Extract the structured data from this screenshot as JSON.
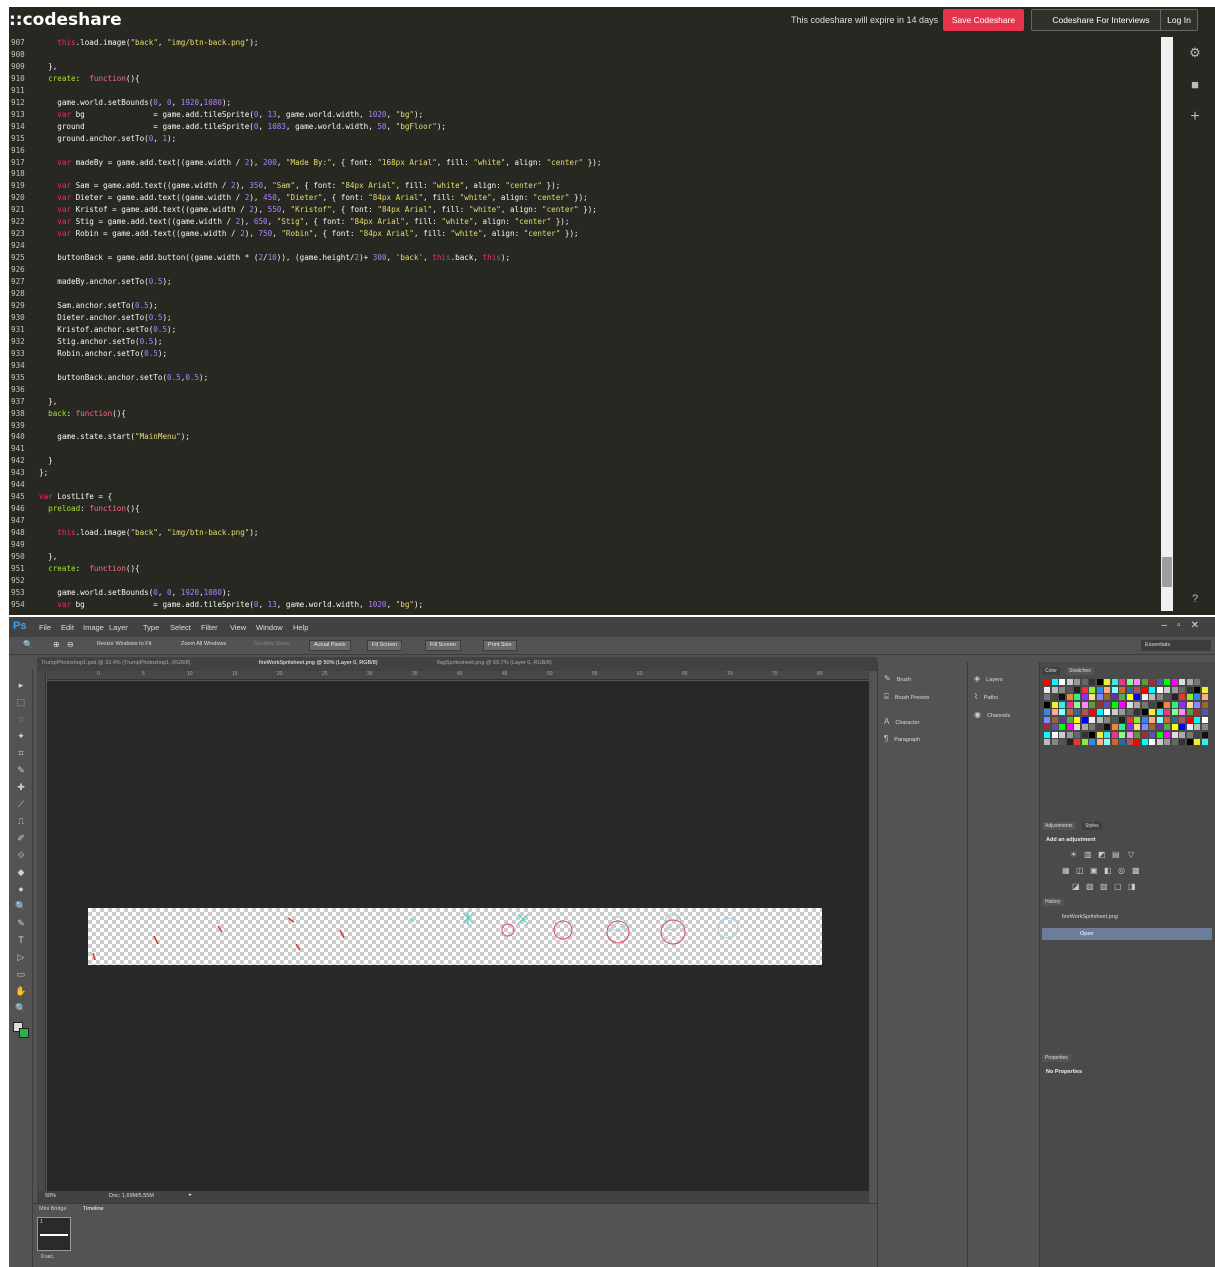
{
  "codeshare": {
    "logo": "::codeshare",
    "expire_text": "This codeshare will expire in 14 days",
    "save_label": "Save Codeshare",
    "interviews_label": "Codeshare For Interviews",
    "login_label": "Log In",
    "side_icons": [
      "gear-icon",
      "camera-icon",
      "plus-icon",
      "help-icon",
      "close-icon"
    ],
    "lines": [
      {
        "n": "907",
        "t": "    this.load.image(\"back\", \"img/btn-back.png\");"
      },
      {
        "n": "908",
        "t": ""
      },
      {
        "n": "909",
        "t": "  },"
      },
      {
        "n": "910",
        "t": "  create:  function(){"
      },
      {
        "n": "911",
        "t": ""
      },
      {
        "n": "912",
        "t": "    game.world.setBounds(0, 0, 1920,1080);"
      },
      {
        "n": "913",
        "t": "    var bg               = game.add.tileSprite(0, 13, game.world.width, 1020, \"bg\");"
      },
      {
        "n": "914",
        "t": "    ground               = game.add.tileSprite(0, 1083, game.world.width, 50, \"bgFloor\");"
      },
      {
        "n": "915",
        "t": "    ground.anchor.setTo(0, 1);"
      },
      {
        "n": "916",
        "t": ""
      },
      {
        "n": "917",
        "t": "    var madeBy = game.add.text((game.width / 2), 200, \"Made By:\", { font: \"168px Arial\", fill: \"white\", align: \"center\" });"
      },
      {
        "n": "918",
        "t": ""
      },
      {
        "n": "919",
        "t": "    var Sam = game.add.text((game.width / 2), 350, \"Sam\", { font: \"84px Arial\", fill: \"white\", align: \"center\" });"
      },
      {
        "n": "920",
        "t": "    var Dieter = game.add.text((game.width / 2), 450, \"Dieter\", { font: \"84px Arial\", fill: \"white\", align: \"center\" });"
      },
      {
        "n": "921",
        "t": "    var Kristof = game.add.text((game.width / 2), 550, \"Kristof\", { font: \"84px Arial\", fill: \"white\", align: \"center\" });"
      },
      {
        "n": "922",
        "t": "    var Stig = game.add.text((game.width / 2), 650, \"Stig\", { font: \"84px Arial\", fill: \"white\", align: \"center\" });"
      },
      {
        "n": "923",
        "t": "    var Robin = game.add.text((game.width / 2), 750, \"Robin\", { font: \"84px Arial\", fill: \"white\", align: \"center\" });"
      },
      {
        "n": "924",
        "t": ""
      },
      {
        "n": "925",
        "t": "    buttonBack = game.add.button((game.width * (2/10)), (game.height/2)+ 300, 'back', this.back, this);"
      },
      {
        "n": "926",
        "t": ""
      },
      {
        "n": "927",
        "t": "    madeBy.anchor.setTo(0.5);"
      },
      {
        "n": "928",
        "t": ""
      },
      {
        "n": "929",
        "t": "    Sam.anchor.setTo(0.5);"
      },
      {
        "n": "930",
        "t": "    Dieter.anchor.setTo(0.5);"
      },
      {
        "n": "931",
        "t": "    Kristof.anchor.setTo(0.5);"
      },
      {
        "n": "932",
        "t": "    Stig.anchor.setTo(0.5);"
      },
      {
        "n": "933",
        "t": "    Robin.anchor.setTo(0.5);"
      },
      {
        "n": "934",
        "t": ""
      },
      {
        "n": "935",
        "t": "    buttonBack.anchor.setTo(0.5,0.5);"
      },
      {
        "n": "936",
        "t": ""
      },
      {
        "n": "937",
        "t": "  },"
      },
      {
        "n": "938",
        "t": "  back: function(){"
      },
      {
        "n": "939",
        "t": ""
      },
      {
        "n": "940",
        "t": "    game.state.start(\"MainMenu\");"
      },
      {
        "n": "941",
        "t": ""
      },
      {
        "n": "942",
        "t": "  }"
      },
      {
        "n": "943",
        "t": "};"
      },
      {
        "n": "944",
        "t": ""
      },
      {
        "n": "945",
        "t": "var LostLife = {"
      },
      {
        "n": "946",
        "t": "  preload: function(){"
      },
      {
        "n": "947",
        "t": ""
      },
      {
        "n": "948",
        "t": "    this.load.image(\"back\", \"img/btn-back.png\");"
      },
      {
        "n": "949",
        "t": ""
      },
      {
        "n": "950",
        "t": "  },"
      },
      {
        "n": "951",
        "t": "  create:  function(){"
      },
      {
        "n": "952",
        "t": ""
      },
      {
        "n": "953",
        "t": "    game.world.setBounds(0, 0, 1920,1080);"
      },
      {
        "n": "954",
        "t": "    var bg               = game.add.tileSprite(0, 13, game.world.width, 1020, \"bg\");"
      }
    ]
  },
  "photoshop": {
    "logo": "Ps",
    "menu": [
      "File",
      "Edit",
      "Image",
      "Layer",
      "Type",
      "Select",
      "Filter",
      "View",
      "Window",
      "Help"
    ],
    "options": {
      "resize_windows": "Resize Windows to Fit",
      "zoom_all": "Zoom All Windows",
      "scrubby_zoom": "Scrubby Zoom",
      "actual_pixels": "Actual Pixels",
      "fit_screen": "Fit Screen",
      "fill_screen": "Fill Screen",
      "print_size": "Print Size",
      "workspace": "Essentials"
    },
    "tabs": [
      "TrumpPhotoshop1.psd @ 33.4% (TrumpPhotoshop1, RGB/8)",
      "fireWorkSpritsheet.png @ 50% (Layer 0, RGB/8)",
      "flagSpritesheet.png @ 66.7% (Layer 0, RGB/8)"
    ],
    "ruler_numbers": [
      "0",
      "5",
      "10",
      "15",
      "20",
      "25",
      "30",
      "35",
      "40",
      "45",
      "50",
      "55",
      "60",
      "65",
      "70",
      "75",
      "80"
    ],
    "status_zoom": "50%",
    "status_doc": "Doc: 1,69M/5,55M",
    "bottom_tabs": [
      "Mini Bridge",
      "Timeline"
    ],
    "frame_number": "1",
    "frame_time": "0 sec.",
    "dock1": [
      "Brush",
      "Brush Presets",
      "Character",
      "Paragraph"
    ],
    "dock2": [
      "Layers",
      "Paths",
      "Channels"
    ],
    "panel_tabs": {
      "color": "Color",
      "swatches": "Swatches",
      "adjustments": "Adjustments",
      "styles": "Styles",
      "history": "History",
      "properties": "Properties"
    },
    "adjustments_title": "Add an adjustment",
    "history": [
      "fireWorkSpritsheet.png",
      "Open"
    ],
    "properties_text": "No Properties",
    "accent_color": "#31a8ff",
    "background_swatch": "#2db04a"
  }
}
